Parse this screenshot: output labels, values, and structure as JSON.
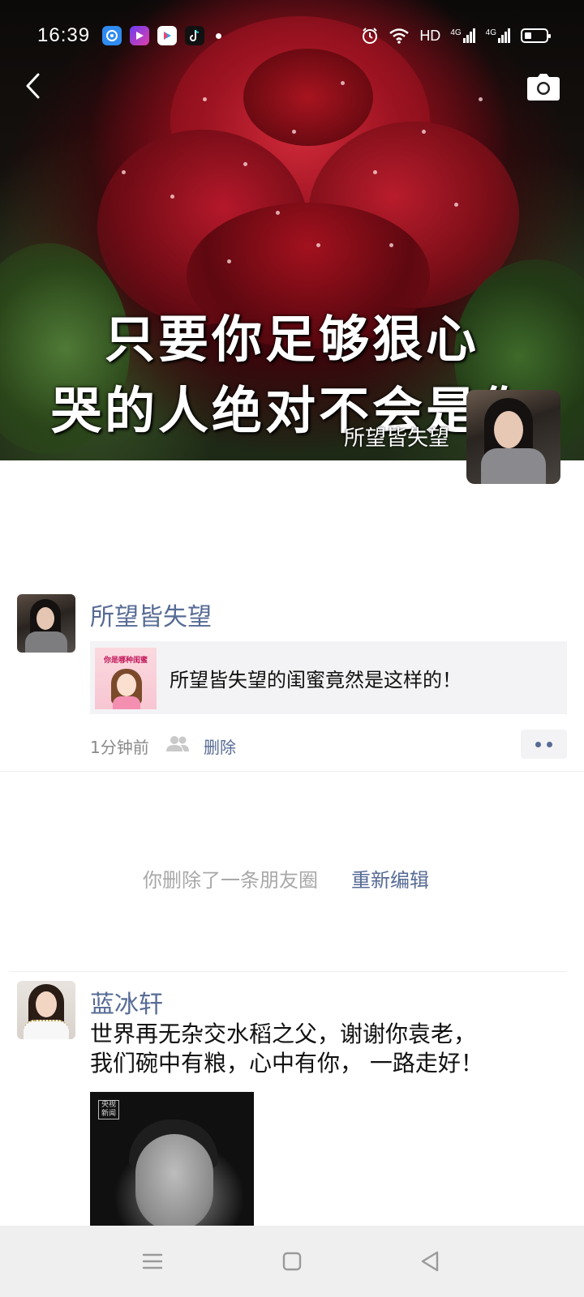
{
  "status_bar": {
    "time": "16:39",
    "network": "HD",
    "signal1": "4G",
    "signal2": "4G",
    "app_icons": [
      "browser-icon",
      "video-player-icon",
      "youku-icon",
      "tiktok-icon"
    ]
  },
  "header": {
    "back_icon": "chevron-left-icon",
    "camera_icon": "camera-icon"
  },
  "cover": {
    "line1": "只要你足够狠心",
    "line2": "哭的人绝对不会是你",
    "profile_name": "所望皆失望"
  },
  "posts": [
    {
      "author": "所望皆失望",
      "shared_title": "所望皆失望的闺蜜竟然是这样的！",
      "thumbnail_caption": "你是哪种闺蜜",
      "time": "1分钟前",
      "delete_label": "删除"
    },
    {
      "author": "蓝冰轩",
      "text_line1": "世界再无杂交水稻之父，谢谢你袁老，",
      "text_line2": "我们碗中有粮，心中有你， 一路走好！",
      "image_watermark": "央视新闻"
    }
  ],
  "deleted_notice": {
    "text": "你删除了一条朋友圈",
    "action": "重新编辑"
  },
  "colors": {
    "link": "#576b95",
    "meta": "#8a8a8a",
    "card_bg": "#f3f3f5",
    "nav_bg": "#efefef"
  },
  "nav_bar": {
    "icons": [
      "menu-icon",
      "home-square-icon",
      "back-triangle-icon"
    ]
  }
}
